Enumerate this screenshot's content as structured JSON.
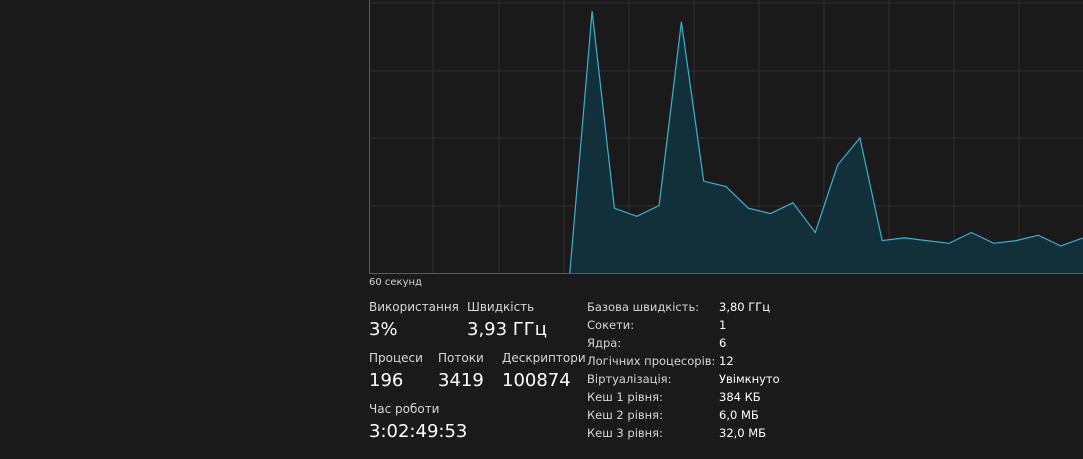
{
  "graph": {
    "time_window_label": "60 секунд",
    "max_value": 100,
    "samples": [
      0,
      0,
      0,
      0,
      0,
      0,
      0,
      0,
      0,
      0,
      97,
      24,
      21,
      25,
      93,
      34,
      32,
      24,
      22,
      26,
      15,
      40,
      50,
      12,
      13,
      12,
      11,
      15,
      11,
      12,
      14,
      10,
      13
    ],
    "colors": {
      "line": "#3ab1d0",
      "fill": "#12303a",
      "grid": "#2f2f2f",
      "border": "#5a5a5a"
    }
  },
  "stats": {
    "usage": {
      "label": "Використання",
      "value": "3%"
    },
    "speed": {
      "label": "Швидкість",
      "value": "3,93 ГГц"
    },
    "processes": {
      "label": "Процеси",
      "value": "196"
    },
    "threads": {
      "label": "Потоки",
      "value": "3419"
    },
    "handles": {
      "label": "Дескриптори",
      "value": "100874"
    },
    "uptime": {
      "label": "Час роботи",
      "value": "3:02:49:53"
    }
  },
  "specs": [
    {
      "key": "Базова швидкість:",
      "value": "3,80 ГГц"
    },
    {
      "key": "Сокети:",
      "value": "1"
    },
    {
      "key": "Ядра:",
      "value": "6"
    },
    {
      "key": "Логічних процесорів:",
      "value": "12"
    },
    {
      "key": "Віртуалізація:",
      "value": "Увімкнуто"
    },
    {
      "key": "Кеш 1 рівня:",
      "value": "384 КБ"
    },
    {
      "key": "Кеш 2 рівня:",
      "value": "6,0 МБ"
    },
    {
      "key": "Кеш 3 рівня:",
      "value": "32,0 МБ"
    }
  ]
}
